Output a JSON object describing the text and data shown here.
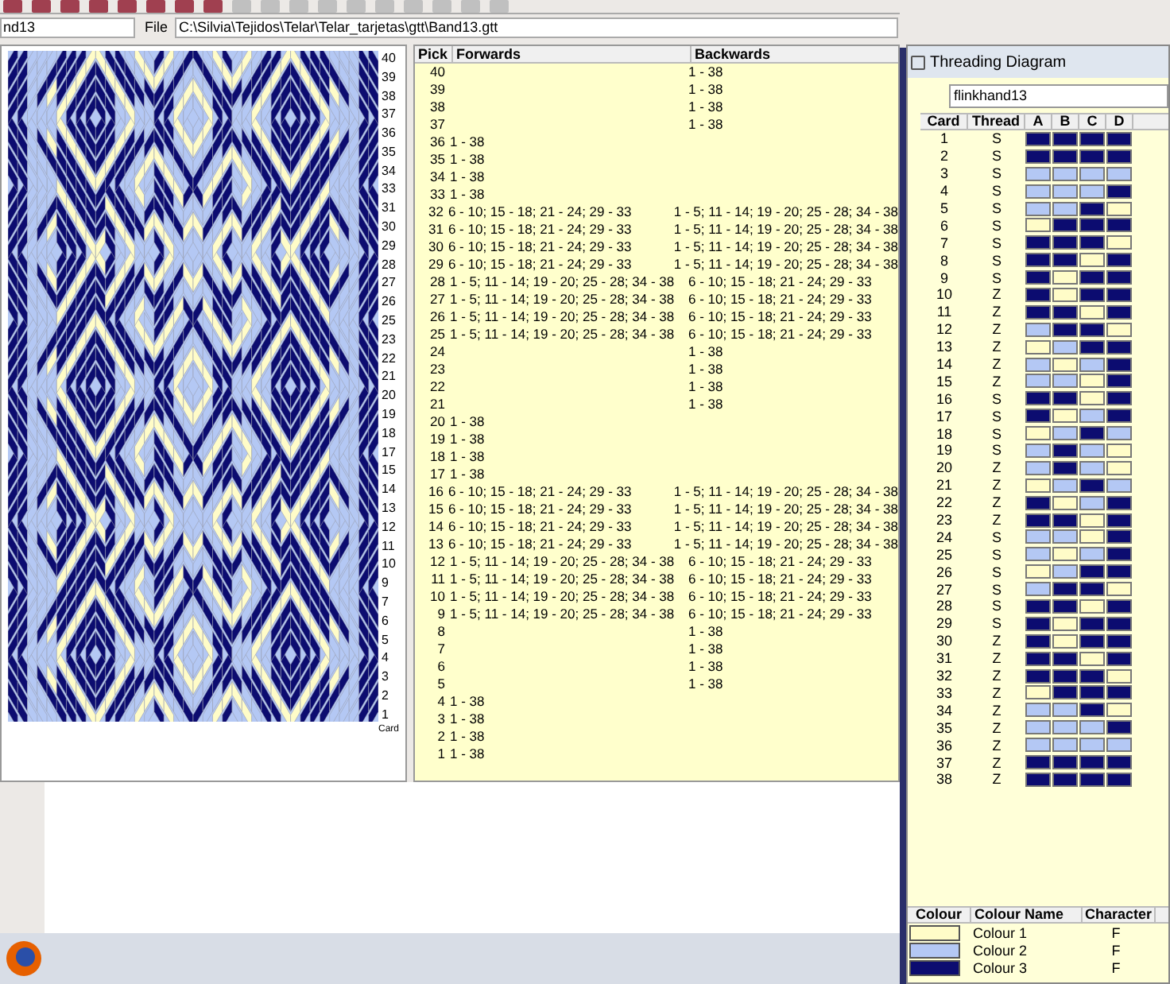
{
  "toolbar": {
    "file_name": "nd13",
    "file_label": "File",
    "file_path": "C:\\Silvia\\Tejidos\\Telar\\Telar_tarjetas\\gtt\\Band13.gtt"
  },
  "pattern": {
    "pick_labels": [
      "40",
      "39",
      "38",
      "37",
      "36",
      "35",
      "34",
      "33",
      "31",
      "30",
      "29",
      "28",
      "27",
      "26",
      "25",
      "23",
      "22",
      "21",
      "20",
      "19",
      "18",
      "17",
      "15",
      "14",
      "13",
      "12",
      "11",
      "10",
      "9",
      "7",
      "6",
      "5",
      "4",
      "3",
      "2",
      "1"
    ],
    "card_label": "Card"
  },
  "pick_table": {
    "columns": [
      "Pick",
      "Forwards",
      "Backwards"
    ],
    "rows": [
      {
        "pick": "40",
        "backwards": "1 - 38"
      },
      {
        "pick": "39",
        "backwards": "1 - 38"
      },
      {
        "pick": "38",
        "backwards": "1 - 38"
      },
      {
        "pick": "37",
        "backwards": "1 - 38"
      },
      {
        "pick": "36",
        "forwards": "1 - 38"
      },
      {
        "pick": "35",
        "forwards": "1 - 38"
      },
      {
        "pick": "34",
        "forwards": "1 - 38"
      },
      {
        "pick": "33",
        "forwards": "1 - 38"
      },
      {
        "pick": "32",
        "forwards": "6 - 10; 15 - 18; 21 - 24; 29 - 33",
        "backwards": "1 - 5; 11 - 14; 19 - 20; 25 - 28; 34 - 38"
      },
      {
        "pick": "31",
        "forwards": "6 - 10; 15 - 18; 21 - 24; 29 - 33",
        "backwards": "1 - 5; 11 - 14; 19 - 20; 25 - 28; 34 - 38"
      },
      {
        "pick": "30",
        "forwards": "6 - 10; 15 - 18; 21 - 24; 29 - 33",
        "backwards": "1 - 5; 11 - 14; 19 - 20; 25 - 28; 34 - 38"
      },
      {
        "pick": "29",
        "forwards": "6 - 10; 15 - 18; 21 - 24; 29 - 33",
        "backwards": "1 - 5; 11 - 14; 19 - 20; 25 - 28; 34 - 38"
      },
      {
        "pick": "28",
        "forwards": "1 - 5; 11 - 14; 19 - 20; 25 - 28; 34 - 38",
        "backwards": "6 - 10; 15 - 18; 21 - 24; 29 - 33"
      },
      {
        "pick": "27",
        "forwards": "1 - 5; 11 - 14; 19 - 20; 25 - 28; 34 - 38",
        "backwards": "6 - 10; 15 - 18; 21 - 24; 29 - 33"
      },
      {
        "pick": "26",
        "forwards": "1 - 5; 11 - 14; 19 - 20; 25 - 28; 34 - 38",
        "backwards": "6 - 10; 15 - 18; 21 - 24; 29 - 33"
      },
      {
        "pick": "25",
        "forwards": "1 - 5; 11 - 14; 19 - 20; 25 - 28; 34 - 38",
        "backwards": "6 - 10; 15 - 18; 21 - 24; 29 - 33"
      },
      {
        "pick": "24",
        "backwards": "1 - 38"
      },
      {
        "pick": "23",
        "backwards": "1 - 38"
      },
      {
        "pick": "22",
        "backwards": "1 - 38"
      },
      {
        "pick": "21",
        "backwards": "1 - 38"
      },
      {
        "pick": "20",
        "forwards": "1 - 38"
      },
      {
        "pick": "19",
        "forwards": "1 - 38"
      },
      {
        "pick": "18",
        "forwards": "1 - 38"
      },
      {
        "pick": "17",
        "forwards": "1 - 38"
      },
      {
        "pick": "16",
        "forwards": "6 - 10; 15 - 18; 21 - 24; 29 - 33",
        "backwards": "1 - 5; 11 - 14; 19 - 20; 25 - 28; 34 - 38"
      },
      {
        "pick": "15",
        "forwards": "6 - 10; 15 - 18; 21 - 24; 29 - 33",
        "backwards": "1 - 5; 11 - 14; 19 - 20; 25 - 28; 34 - 38"
      },
      {
        "pick": "14",
        "forwards": "6 - 10; 15 - 18; 21 - 24; 29 - 33",
        "backwards": "1 - 5; 11 - 14; 19 - 20; 25 - 28; 34 - 38"
      },
      {
        "pick": "13",
        "forwards": "6 - 10; 15 - 18; 21 - 24; 29 - 33",
        "backwards": "1 - 5; 11 - 14; 19 - 20; 25 - 28; 34 - 38"
      },
      {
        "pick": "12",
        "forwards": "1 - 5; 11 - 14; 19 - 20; 25 - 28; 34 - 38",
        "backwards": "6 - 10; 15 - 18; 21 - 24; 29 - 33"
      },
      {
        "pick": "11",
        "forwards": "1 - 5; 11 - 14; 19 - 20; 25 - 28; 34 - 38",
        "backwards": "6 - 10; 15 - 18; 21 - 24; 29 - 33"
      },
      {
        "pick": "10",
        "forwards": "1 - 5; 11 - 14; 19 - 20; 25 - 28; 34 - 38",
        "backwards": "6 - 10; 15 - 18; 21 - 24; 29 - 33"
      },
      {
        "pick": "9",
        "forwards": "1 - 5; 11 - 14; 19 - 20; 25 - 28; 34 - 38",
        "backwards": "6 - 10; 15 - 18; 21 - 24; 29 - 33"
      },
      {
        "pick": "8",
        "backwards": "1 - 38"
      },
      {
        "pick": "7",
        "backwards": "1 - 38"
      },
      {
        "pick": "6",
        "backwards": "1 - 38"
      },
      {
        "pick": "5",
        "backwards": "1 - 38"
      },
      {
        "pick": "4",
        "forwards": "1 - 38"
      },
      {
        "pick": "3",
        "forwards": "1 - 38"
      },
      {
        "pick": "2",
        "forwards": "1 - 38"
      },
      {
        "pick": "1",
        "forwards": "1 - 38"
      }
    ]
  },
  "threading_window": {
    "title": "Threading Diagram",
    "name": "flinkhand13",
    "columns": [
      "Card",
      "Thread",
      "A",
      "B",
      "C",
      "D"
    ],
    "rows": [
      {
        "card": "1",
        "thread": "S",
        "holes": [
          {
            "color": "#0c0c70"
          },
          {
            "color": "#0c0c70"
          },
          {
            "color": "#0c0c70"
          },
          {
            "color": "#0c0c70"
          }
        ]
      },
      {
        "card": "2",
        "thread": "S",
        "holes": [
          {
            "color": "#0c0c70"
          },
          {
            "color": "#0c0c70"
          },
          {
            "color": "#0c0c70"
          },
          {
            "color": "#0c0c70"
          }
        ]
      },
      {
        "card": "3",
        "thread": "S",
        "holes": [
          {
            "color": "#b4c8f4"
          },
          {
            "color": "#b4c8f4"
          },
          {
            "color": "#b4c8f4"
          },
          {
            "color": "#b4c8f4"
          }
        ]
      },
      {
        "card": "4",
        "thread": "S",
        "holes": [
          {
            "color": "#b4c8f4"
          },
          {
            "color": "#b4c8f4"
          },
          {
            "color": "#b4c8f4"
          },
          {
            "color": "#0c0c70"
          }
        ]
      },
      {
        "card": "5",
        "thread": "S",
        "holes": [
          {
            "color": "#b4c8f4"
          },
          {
            "color": "#b4c8f4"
          },
          {
            "color": "#0c0c70"
          },
          {
            "color": "#fffcc8"
          }
        ]
      },
      {
        "card": "6",
        "thread": "S",
        "holes": [
          {
            "color": "#fffcc8"
          },
          {
            "color": "#0c0c70"
          },
          {
            "color": "#0c0c70"
          },
          {
            "color": "#0c0c70"
          }
        ]
      },
      {
        "card": "7",
        "thread": "S",
        "holes": [
          {
            "color": "#0c0c70"
          },
          {
            "color": "#0c0c70"
          },
          {
            "color": "#0c0c70"
          },
          {
            "color": "#fffcc8"
          }
        ]
      },
      {
        "card": "8",
        "thread": "S",
        "holes": [
          {
            "color": "#0c0c70"
          },
          {
            "color": "#0c0c70"
          },
          {
            "color": "#fffcc8"
          },
          {
            "color": "#0c0c70"
          }
        ]
      },
      {
        "card": "9",
        "thread": "S",
        "holes": [
          {
            "color": "#0c0c70"
          },
          {
            "color": "#fffcc8"
          },
          {
            "color": "#0c0c70"
          },
          {
            "color": "#0c0c70"
          }
        ]
      },
      {
        "card": "10",
        "thread": "Z",
        "holes": [
          {
            "color": "#0c0c70"
          },
          {
            "color": "#fffcc8"
          },
          {
            "color": "#0c0c70"
          },
          {
            "color": "#0c0c70"
          }
        ]
      },
      {
        "card": "11",
        "thread": "Z",
        "holes": [
          {
            "color": "#0c0c70"
          },
          {
            "color": "#0c0c70"
          },
          {
            "color": "#fffcc8"
          },
          {
            "color": "#0c0c70"
          }
        ]
      },
      {
        "card": "12",
        "thread": "Z",
        "holes": [
          {
            "color": "#b4c8f4"
          },
          {
            "color": "#0c0c70"
          },
          {
            "color": "#0c0c70"
          },
          {
            "color": "#fffcc8"
          }
        ]
      },
      {
        "card": "13",
        "thread": "Z",
        "holes": [
          {
            "color": "#fffcc8"
          },
          {
            "color": "#b4c8f4"
          },
          {
            "color": "#0c0c70"
          },
          {
            "color": "#0c0c70"
          }
        ]
      },
      {
        "card": "14",
        "thread": "Z",
        "holes": [
          {
            "color": "#b4c8f4"
          },
          {
            "color": "#fffcc8"
          },
          {
            "color": "#b4c8f4"
          },
          {
            "color": "#0c0c70"
          }
        ]
      },
      {
        "card": "15",
        "thread": "Z",
        "holes": [
          {
            "color": "#b4c8f4"
          },
          {
            "color": "#b4c8f4"
          },
          {
            "color": "#fffcc8"
          },
          {
            "color": "#0c0c70"
          }
        ]
      },
      {
        "card": "16",
        "thread": "S",
        "holes": [
          {
            "color": "#0c0c70"
          },
          {
            "color": "#0c0c70"
          },
          {
            "color": "#fffcc8"
          },
          {
            "color": "#0c0c70"
          }
        ]
      },
      {
        "card": "17",
        "thread": "S",
        "holes": [
          {
            "color": "#0c0c70"
          },
          {
            "color": "#fffcc8"
          },
          {
            "color": "#b4c8f4"
          },
          {
            "color": "#0c0c70"
          }
        ]
      },
      {
        "card": "18",
        "thread": "S",
        "holes": [
          {
            "color": "#fffcc8"
          },
          {
            "color": "#b4c8f4"
          },
          {
            "color": "#0c0c70"
          },
          {
            "color": "#b4c8f4"
          }
        ]
      },
      {
        "card": "19",
        "thread": "S",
        "holes": [
          {
            "color": "#b4c8f4"
          },
          {
            "color": "#0c0c70"
          },
          {
            "color": "#b4c8f4"
          },
          {
            "color": "#fffcc8"
          }
        ]
      },
      {
        "card": "20",
        "thread": "Z",
        "holes": [
          {
            "color": "#b4c8f4"
          },
          {
            "color": "#0c0c70"
          },
          {
            "color": "#b4c8f4"
          },
          {
            "color": "#fffcc8"
          }
        ]
      },
      {
        "card": "21",
        "thread": "Z",
        "holes": [
          {
            "color": "#fffcc8"
          },
          {
            "color": "#b4c8f4"
          },
          {
            "color": "#0c0c70"
          },
          {
            "color": "#b4c8f4"
          }
        ]
      },
      {
        "card": "22",
        "thread": "Z",
        "holes": [
          {
            "color": "#0c0c70"
          },
          {
            "color": "#fffcc8"
          },
          {
            "color": "#b4c8f4"
          },
          {
            "color": "#0c0c70"
          }
        ]
      },
      {
        "card": "23",
        "thread": "Z",
        "holes": [
          {
            "color": "#0c0c70"
          },
          {
            "color": "#0c0c70"
          },
          {
            "color": "#fffcc8"
          },
          {
            "color": "#0c0c70"
          }
        ]
      },
      {
        "card": "24",
        "thread": "S",
        "holes": [
          {
            "color": "#b4c8f4"
          },
          {
            "color": "#b4c8f4"
          },
          {
            "color": "#fffcc8"
          },
          {
            "color": "#0c0c70"
          }
        ]
      },
      {
        "card": "25",
        "thread": "S",
        "holes": [
          {
            "color": "#b4c8f4"
          },
          {
            "color": "#fffcc8"
          },
          {
            "color": "#b4c8f4"
          },
          {
            "color": "#0c0c70"
          }
        ]
      },
      {
        "card": "26",
        "thread": "S",
        "holes": [
          {
            "color": "#fffcc8"
          },
          {
            "color": "#b4c8f4"
          },
          {
            "color": "#0c0c70"
          },
          {
            "color": "#0c0c70"
          }
        ]
      },
      {
        "card": "27",
        "thread": "S",
        "holes": [
          {
            "color": "#b4c8f4"
          },
          {
            "color": "#0c0c70"
          },
          {
            "color": "#0c0c70"
          },
          {
            "color": "#fffcc8"
          }
        ]
      },
      {
        "card": "28",
        "thread": "S",
        "holes": [
          {
            "color": "#0c0c70"
          },
          {
            "color": "#0c0c70"
          },
          {
            "color": "#fffcc8"
          },
          {
            "color": "#0c0c70"
          }
        ]
      },
      {
        "card": "29",
        "thread": "S",
        "holes": [
          {
            "color": "#0c0c70"
          },
          {
            "color": "#fffcc8"
          },
          {
            "color": "#0c0c70"
          },
          {
            "color": "#0c0c70"
          }
        ]
      },
      {
        "card": "30",
        "thread": "Z",
        "holes": [
          {
            "color": "#0c0c70"
          },
          {
            "color": "#fffcc8"
          },
          {
            "color": "#0c0c70"
          },
          {
            "color": "#0c0c70"
          }
        ]
      },
      {
        "card": "31",
        "thread": "Z",
        "holes": [
          {
            "color": "#0c0c70"
          },
          {
            "color": "#0c0c70"
          },
          {
            "color": "#fffcc8"
          },
          {
            "color": "#0c0c70"
          }
        ]
      },
      {
        "card": "32",
        "thread": "Z",
        "holes": [
          {
            "color": "#0c0c70"
          },
          {
            "color": "#0c0c70"
          },
          {
            "color": "#0c0c70"
          },
          {
            "color": "#fffcc8"
          }
        ]
      },
      {
        "card": "33",
        "thread": "Z",
        "holes": [
          {
            "color": "#fffcc8"
          },
          {
            "color": "#0c0c70"
          },
          {
            "color": "#0c0c70"
          },
          {
            "color": "#0c0c70"
          }
        ]
      },
      {
        "card": "34",
        "thread": "Z",
        "holes": [
          {
            "color": "#b4c8f4"
          },
          {
            "color": "#b4c8f4"
          },
          {
            "color": "#0c0c70"
          },
          {
            "color": "#fffcc8"
          }
        ]
      },
      {
        "card": "35",
        "thread": "Z",
        "holes": [
          {
            "color": "#b4c8f4"
          },
          {
            "color": "#b4c8f4"
          },
          {
            "color": "#b4c8f4"
          },
          {
            "color": "#0c0c70"
          }
        ]
      },
      {
        "card": "36",
        "thread": "Z",
        "holes": [
          {
            "color": "#b4c8f4"
          },
          {
            "color": "#b4c8f4"
          },
          {
            "color": "#b4c8f4"
          },
          {
            "color": "#b4c8f4"
          }
        ]
      },
      {
        "card": "37",
        "thread": "Z",
        "holes": [
          {
            "color": "#0c0c70"
          },
          {
            "color": "#0c0c70"
          },
          {
            "color": "#0c0c70"
          },
          {
            "color": "#0c0c70"
          }
        ]
      },
      {
        "card": "38",
        "thread": "Z",
        "holes": [
          {
            "color": "#0c0c70"
          },
          {
            "color": "#0c0c70"
          },
          {
            "color": "#0c0c70"
          },
          {
            "color": "#0c0c70"
          }
        ]
      }
    ],
    "legend": {
      "columns": [
        "Colour",
        "Colour Name",
        "Character"
      ],
      "rows": [
        {
          "color": "#fffcc8",
          "name": "Colour 1",
          "character": "F"
        },
        {
          "color": "#b4c8f4",
          "name": "Colour 2",
          "character": "F"
        },
        {
          "color": "#0c0c70",
          "name": "Colour 3",
          "character": "F"
        }
      ]
    }
  }
}
